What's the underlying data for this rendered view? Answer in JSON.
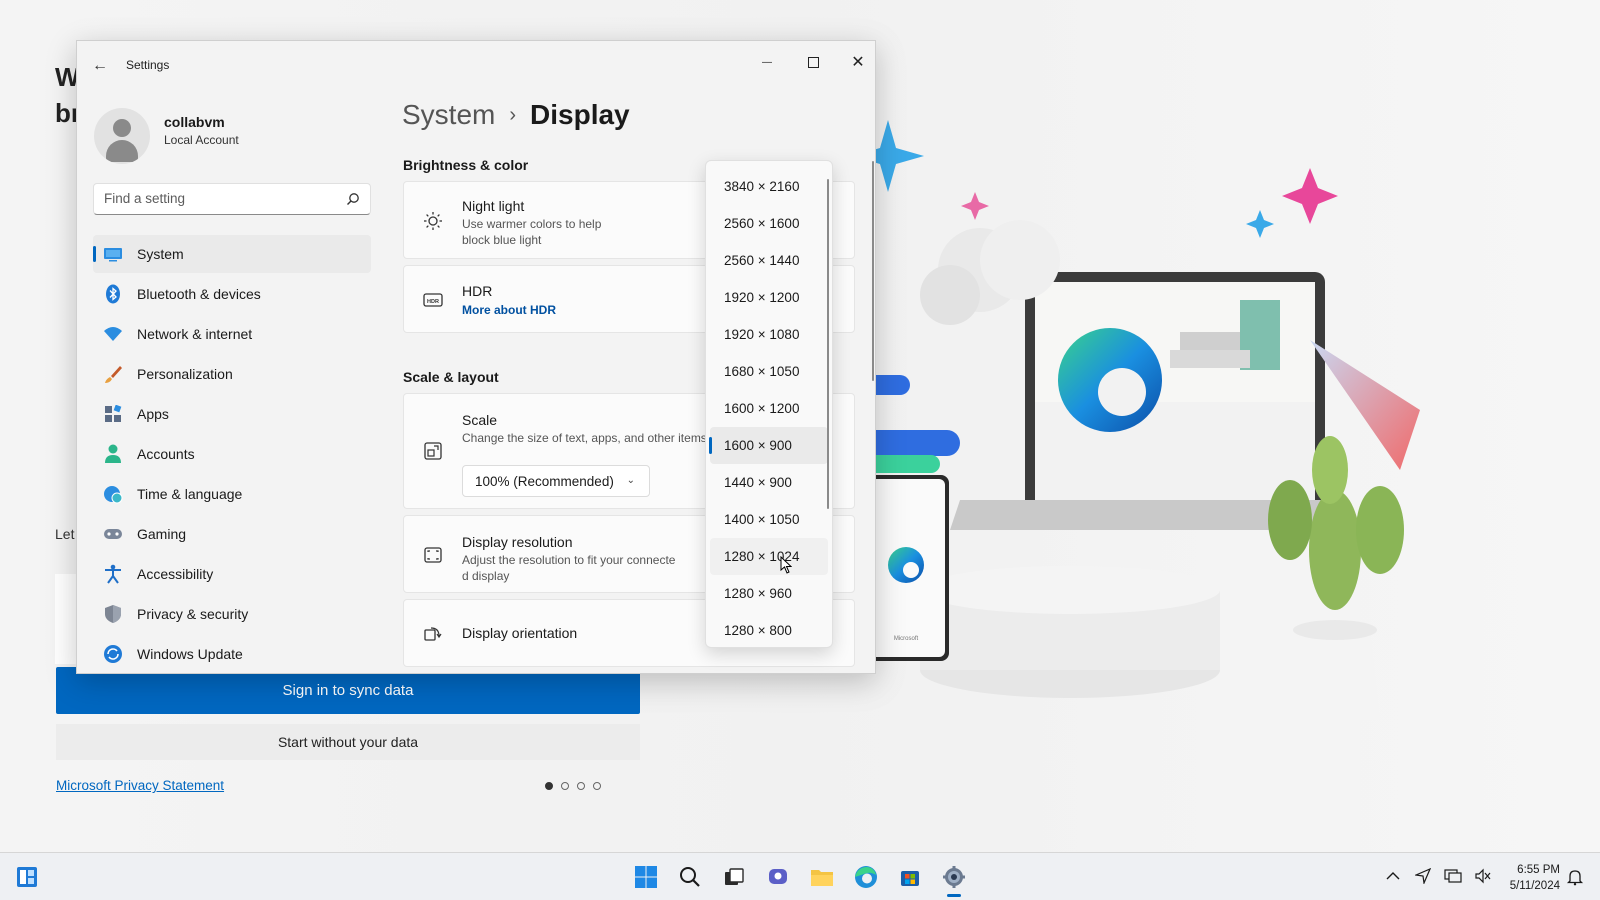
{
  "background": {
    "heading_line1": "W",
    "heading_line2": "br",
    "let_text": "Let",
    "sign_in_label": "Sign in to sync data",
    "start_label": "Start without your data",
    "privacy_label": "Microsoft Privacy Statement",
    "phone_brand": "Microsoft"
  },
  "window": {
    "title": "Settings",
    "back_glyph": "←",
    "minimize_glyph": "—",
    "close_glyph": "✕"
  },
  "user": {
    "name": "collabvm",
    "account_type": "Local Account"
  },
  "search": {
    "placeholder": "Find a setting"
  },
  "nav": {
    "items": [
      {
        "label": "System",
        "icon": "system-icon",
        "selected": true
      },
      {
        "label": "Bluetooth & devices",
        "icon": "bluetooth-icon"
      },
      {
        "label": "Network & internet",
        "icon": "wifi-icon"
      },
      {
        "label": "Personalization",
        "icon": "brush-icon"
      },
      {
        "label": "Apps",
        "icon": "apps-icon"
      },
      {
        "label": "Accounts",
        "icon": "person-icon"
      },
      {
        "label": "Time & language",
        "icon": "globe-clock-icon"
      },
      {
        "label": "Gaming",
        "icon": "controller-icon"
      },
      {
        "label": "Accessibility",
        "icon": "accessibility-icon"
      },
      {
        "label": "Privacy & security",
        "icon": "shield-icon"
      },
      {
        "label": "Windows Update",
        "icon": "update-icon"
      }
    ]
  },
  "breadcrumb": {
    "parent": "System",
    "separator": "›",
    "current": "Display"
  },
  "sections": {
    "brightness_title": "Brightness & color",
    "scale_title": "Scale & layout"
  },
  "cards": {
    "night_light": {
      "title": "Night light",
      "desc_line1": "Use warmer colors to help",
      "desc_line2": "block blue light"
    },
    "hdr": {
      "title": "HDR",
      "link": "More about HDR"
    },
    "scale": {
      "title": "Scale",
      "desc": "Change the size of text, apps, and other items",
      "value": "100% (Recommended)"
    },
    "resolution": {
      "title": "Display resolution",
      "desc_line1": "Adjust the resolution to fit your connecte",
      "desc_line2": "d display"
    },
    "orientation": {
      "title": "Display orientation"
    }
  },
  "resolution_dropdown": {
    "options": [
      "3840 × 2160",
      "2560 × 1600",
      "2560 × 1440",
      "1920 × 1200",
      "1920 × 1080",
      "1680 × 1050",
      "1600 × 1200",
      "1600 × 900",
      "1440 × 900",
      "1400 × 1050",
      "1280 × 1024",
      "1280 × 960",
      "1280 × 800"
    ],
    "selected": "1600 × 900",
    "hovered": "1280 × 1024"
  },
  "taskbar": {
    "apps": [
      "start-icon",
      "search-icon",
      "task-view-icon",
      "chat-icon",
      "file-explorer-icon",
      "edge-icon",
      "store-icon",
      "settings-icon"
    ],
    "active_app": "settings-icon",
    "time": "6:55 PM",
    "date": "5/11/2024"
  },
  "colors": {
    "accent": "#0067c0",
    "window_bg": "#f3f3f3",
    "taskbar_bg": "#eef0f3"
  }
}
